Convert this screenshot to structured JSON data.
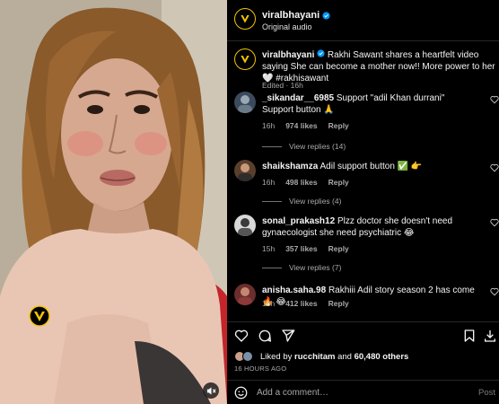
{
  "header": {
    "username": "viralbhayani",
    "subtitle": "Original audio"
  },
  "caption": {
    "username": "viralbhayani",
    "text": "Rakhi Sawant shares a heartfelt video saying She can become a mother now!! More power to her🤍 #rakhisawant",
    "meta": "Edited · 16h"
  },
  "comments": [
    {
      "username": "_sikandar__6985",
      "text": "Support \"adil Khan durrani\" Support button 🙏",
      "time": "16h",
      "likes": "974 likes",
      "reply": "Reply",
      "replies": "View replies (14)"
    },
    {
      "username": "shaikshamza",
      "text": "Adil support button ✅ 👉",
      "time": "16h",
      "likes": "498 likes",
      "reply": "Reply",
      "replies": "View replies (4)"
    },
    {
      "username": "sonal_prakash12",
      "text": "Plzz doctor she doesn't need gynaecologist she need psychiatric 😂",
      "time": "15h",
      "likes": "357 likes",
      "reply": "Reply",
      "replies": "View replies (7)"
    },
    {
      "username": "anisha.saha.98",
      "text": "Rakhiii Adil story season 2 has come 🔥 😂",
      "time": "16h",
      "likes": "412 likes",
      "reply": "Reply"
    }
  ],
  "likes": {
    "prefix": "Liked by ",
    "user": "rucchitam",
    "middle": " and ",
    "others": "60,480 others"
  },
  "time_ago": "16 HOURS AGO",
  "add_comment": {
    "placeholder": "Add a comment…",
    "post_label": "Post"
  },
  "colors": {
    "background": "#000000",
    "muted_text": "#a8a8a8",
    "divider": "#262626",
    "verified": "#0095f6",
    "brand_yellow": "#f4c400"
  }
}
